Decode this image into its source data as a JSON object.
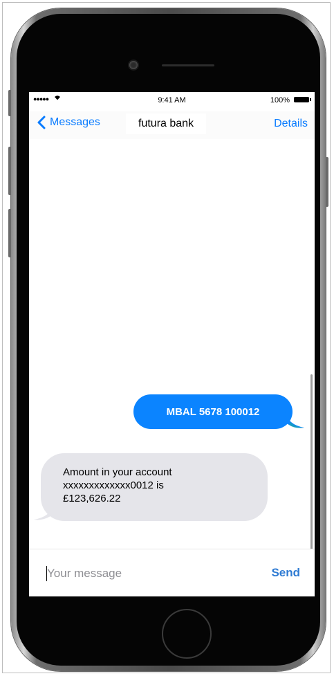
{
  "status_bar": {
    "signal": "●●●●●",
    "wifi_icon": "wifi-icon",
    "time": "9:41 AM",
    "battery": "100%"
  },
  "nav": {
    "back_label": "Messages",
    "title": "futura bank",
    "details_label": "Details"
  },
  "messages": {
    "outgoing": "MBAL 5678 100012",
    "incoming_line1": "Amount in your account",
    "incoming_line2": "xxxxxxxxxxxxx0012 is",
    "incoming_line3": "£123,626.22"
  },
  "composer": {
    "placeholder": "Your message",
    "send_label": "Send"
  },
  "colors": {
    "accent": "#0a7cff",
    "outgoing_bubble": "#0b84ff",
    "incoming_bubble": "#e5e5ea"
  }
}
